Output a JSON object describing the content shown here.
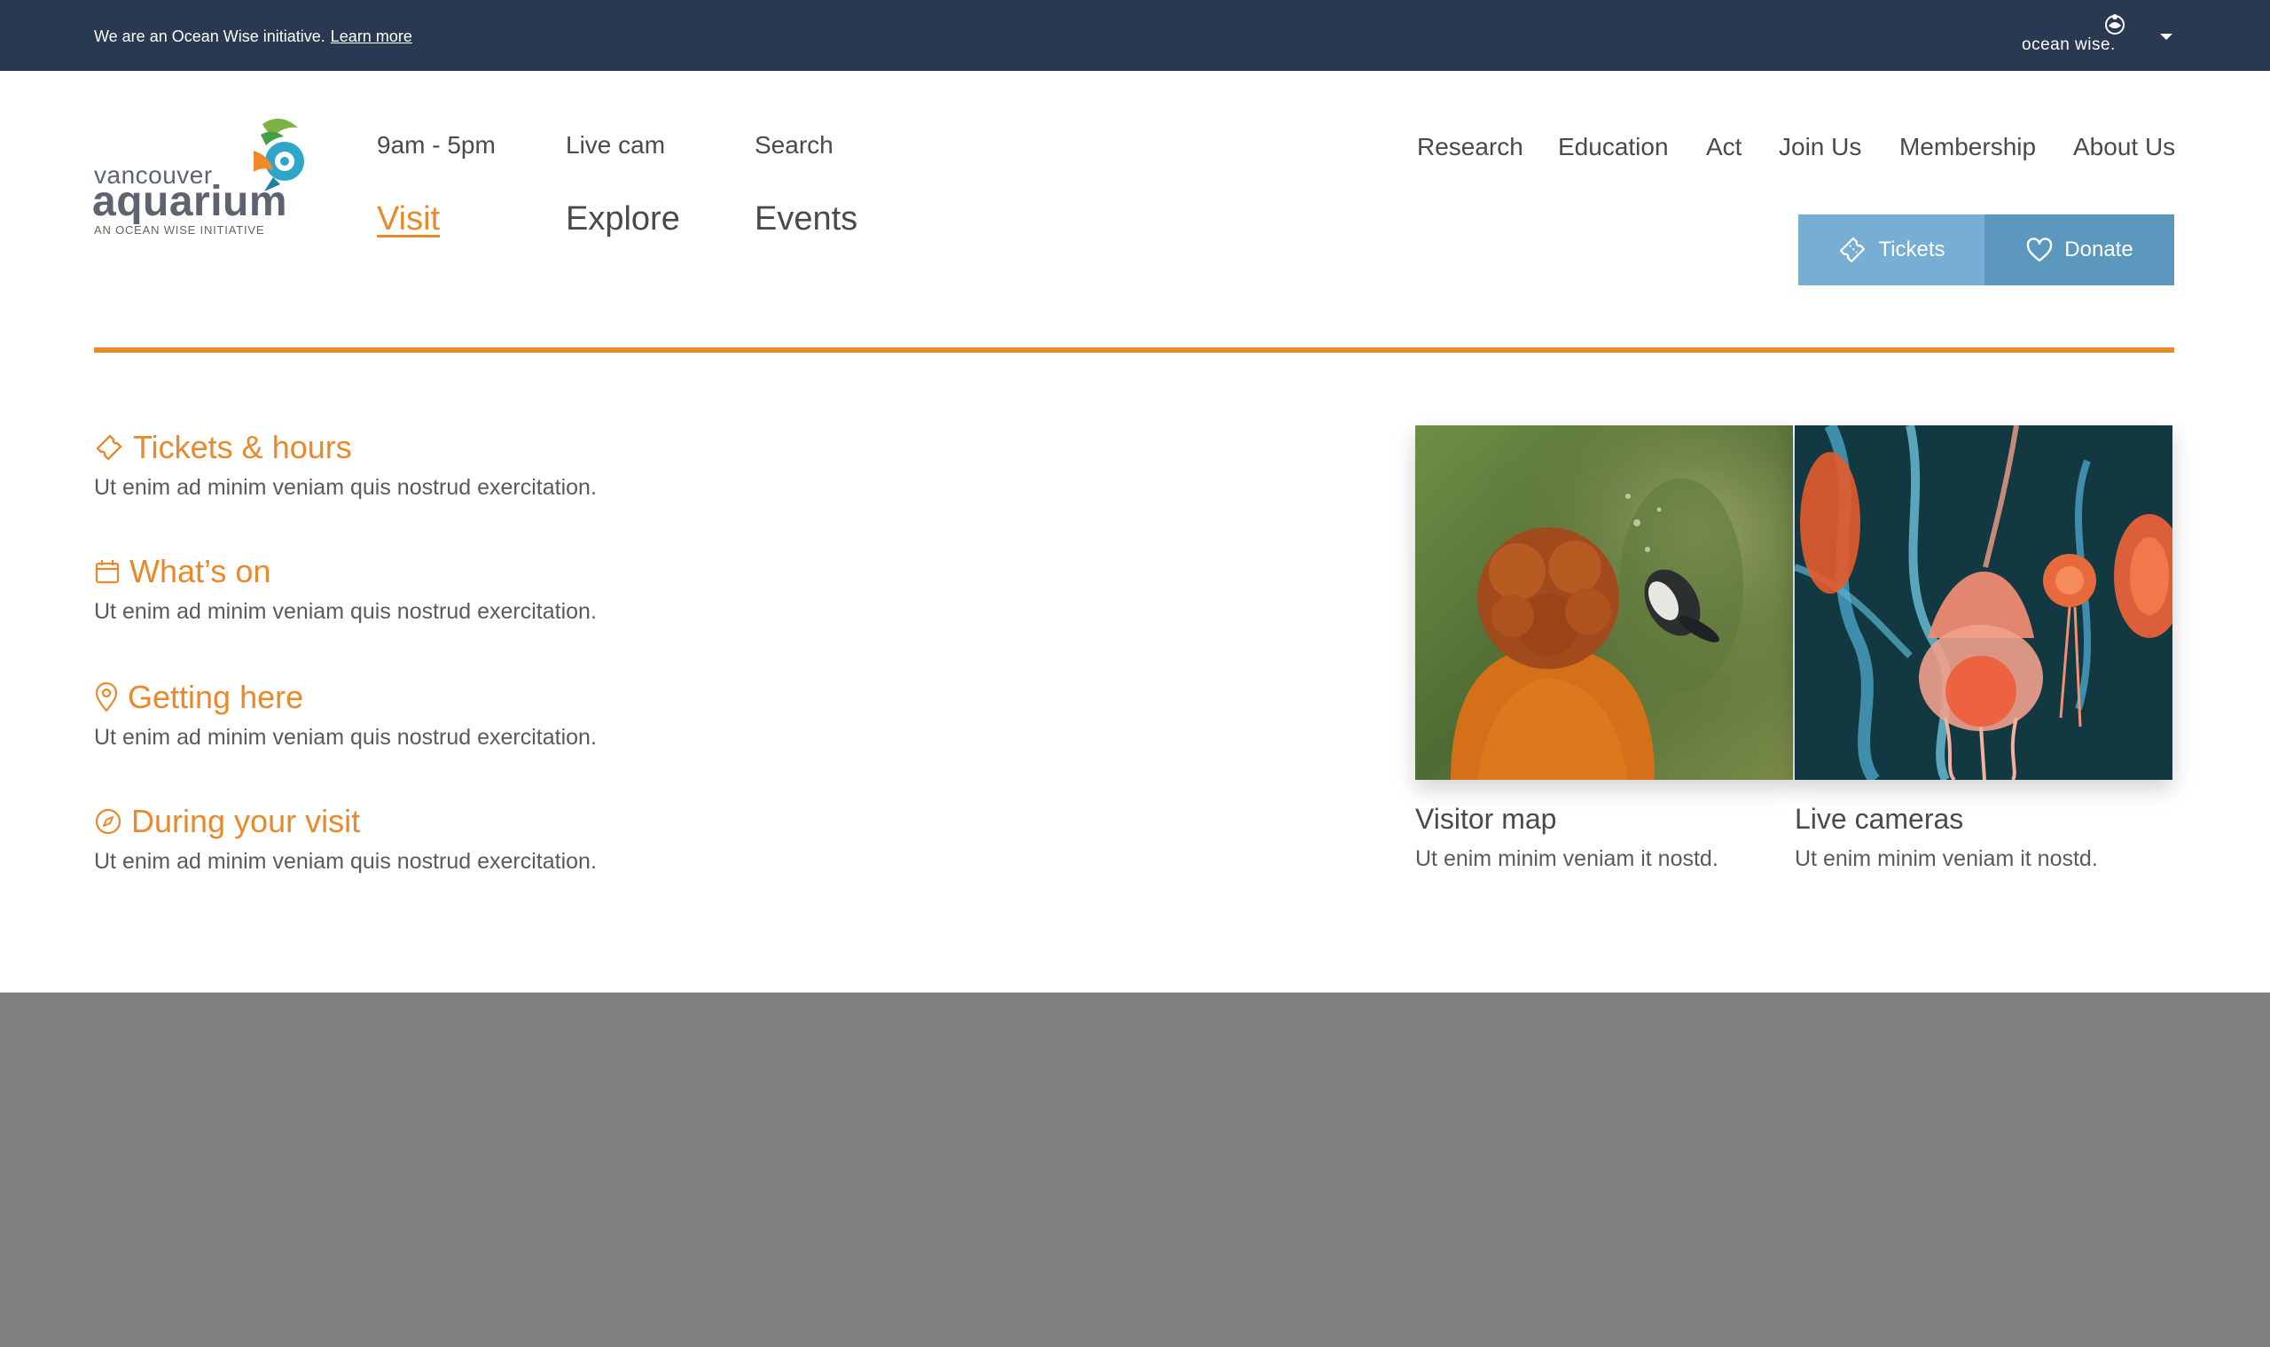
{
  "topbar": {
    "notice": "We are an Ocean Wise initiative.",
    "learn_more": "Learn more",
    "ow_logo_text": "ocean wise.",
    "bg_color": "#283951"
  },
  "brand": {
    "line1": "vancouver",
    "line2": "aquarium",
    "line3": "AN OCEAN WISE INITIATIVE"
  },
  "util_nav": [
    "9am - 5pm",
    "Live cam",
    "Search"
  ],
  "main_nav": [
    "Visit",
    "Explore",
    "Events"
  ],
  "right_nav": [
    "Research",
    "Education",
    "Act",
    "Join Us",
    "Membership",
    "About Us"
  ],
  "buttons": {
    "tickets": "Tickets",
    "donate": "Donate"
  },
  "links": [
    {
      "title": "Tickets & hours",
      "desc": "Ut enim ad minim veniam quis nostrud exercitation.",
      "icon": "ticket-icon"
    },
    {
      "title": "What’s on",
      "desc": "Ut enim ad minim veniam quis nostrud exercitation.",
      "icon": "calendar-icon"
    },
    {
      "title": "Getting here",
      "desc": "Ut enim ad minim veniam quis nostrud exercitation.",
      "icon": "map-pin-icon"
    },
    {
      "title": "During your visit",
      "desc": "Ut enim ad minim veniam quis nostrud exercitation.",
      "icon": "compass-icon"
    }
  ],
  "cards": [
    {
      "title": "Visitor map",
      "desc": "Ut enim minim veniam it nostd."
    },
    {
      "title": "Live cameras",
      "desc": "Ut enim minim veniam it nostd."
    }
  ],
  "colors": {
    "accent": "#e8892b",
    "tickets_btn": "#78aed3",
    "donate_btn": "#5c97be",
    "footer_band": "#808080"
  }
}
